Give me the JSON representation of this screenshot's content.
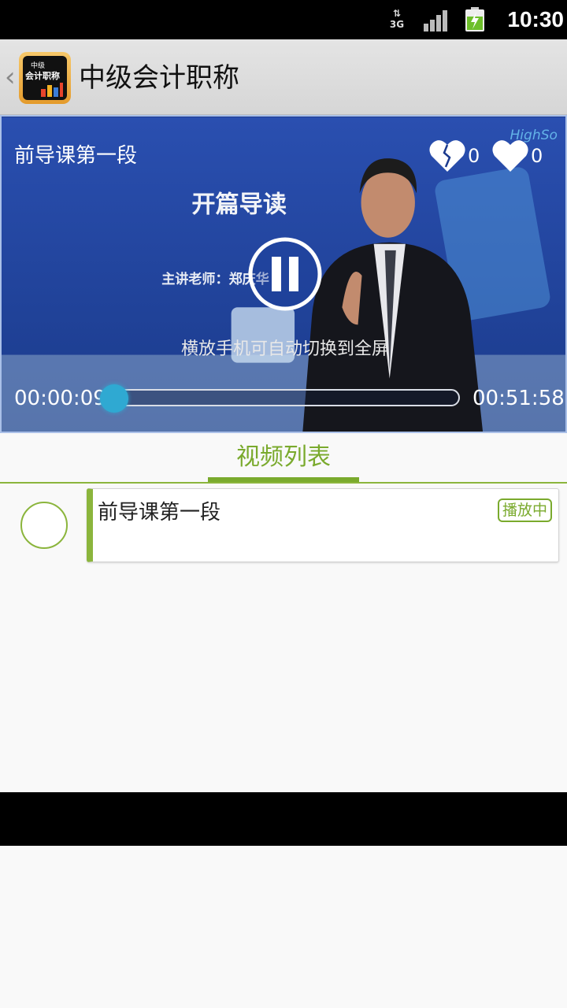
{
  "status_bar": {
    "network": "3G",
    "time": "10:30"
  },
  "title_bar": {
    "icon_line1": "中级",
    "icon_line2": "会计职称",
    "title": "中级会计职称"
  },
  "video": {
    "title": "前导课第一段",
    "slide_heading": "开篇导读",
    "slide_teacher": "主讲老师：郑庆华",
    "watermark": "HighSo",
    "hint": "横放手机可自动切换到全屏",
    "dislike_count": "0",
    "like_count": "0",
    "current_time": "00:00:09",
    "total_time": "00:51:58",
    "progress_fraction": 0.003
  },
  "tabs": {
    "video_list": "视频列表"
  },
  "list": [
    {
      "title": "前导课第一段",
      "badge": "播放中"
    }
  ],
  "colors": {
    "accent": "#7aaa2d",
    "seek": "#2aa3c9"
  }
}
